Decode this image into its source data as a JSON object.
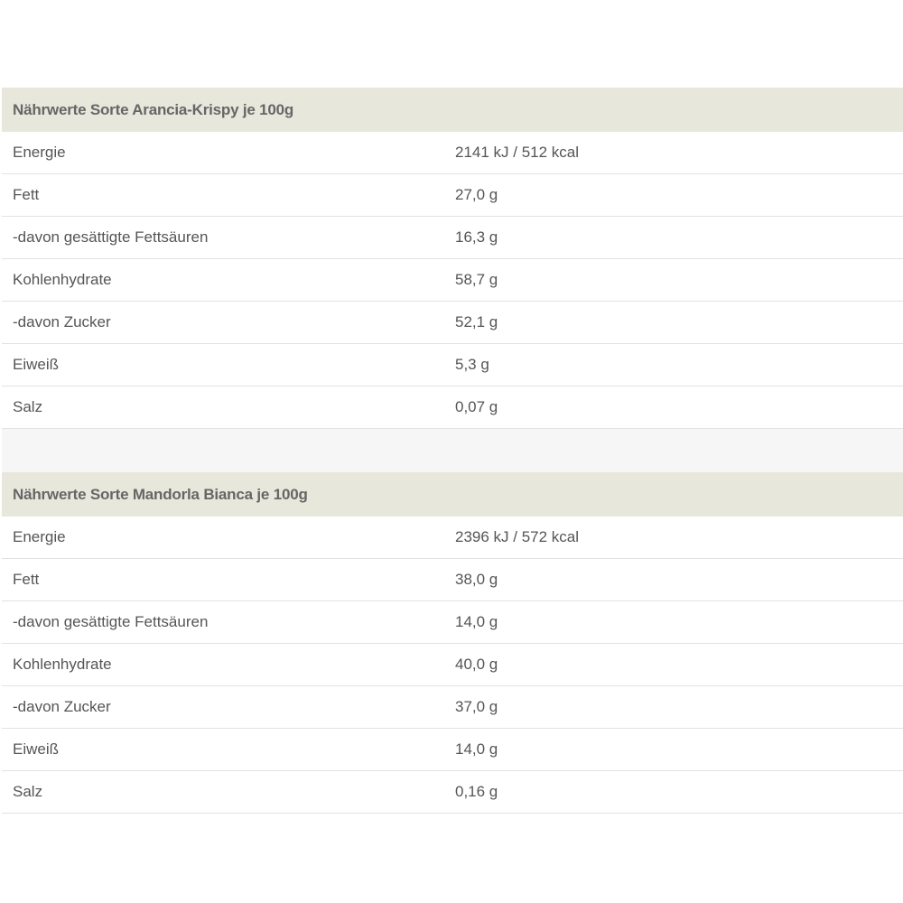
{
  "sections": [
    {
      "title": "Nährwerte Sorte Arancia-Krispy je 100g",
      "rows": [
        {
          "label": "Energie",
          "value": "2141 kJ / 512 kcal"
        },
        {
          "label": "Fett",
          "value": "27,0 g"
        },
        {
          "label": "-davon gesättigte Fettsäuren",
          "value": "16,3 g"
        },
        {
          "label": "Kohlenhydrate",
          "value": "58,7 g"
        },
        {
          "label": "-davon Zucker",
          "value": "52,1 g"
        },
        {
          "label": "Eiweiß",
          "value": "5,3 g"
        },
        {
          "label": "Salz",
          "value": "0,07 g"
        }
      ]
    },
    {
      "title": "Nährwerte Sorte Mandorla Bianca je 100g",
      "rows": [
        {
          "label": "Energie",
          "value": "2396 kJ / 572 kcal"
        },
        {
          "label": "Fett",
          "value": "38,0 g"
        },
        {
          "label": "-davon gesättigte Fettsäuren",
          "value": "14,0 g"
        },
        {
          "label": "Kohlenhydrate",
          "value": "40,0 g"
        },
        {
          "label": "-davon Zucker",
          "value": "37,0 g"
        },
        {
          "label": "Eiweiß",
          "value": "14,0 g"
        },
        {
          "label": "Salz",
          "value": "0,16 g"
        }
      ]
    }
  ]
}
